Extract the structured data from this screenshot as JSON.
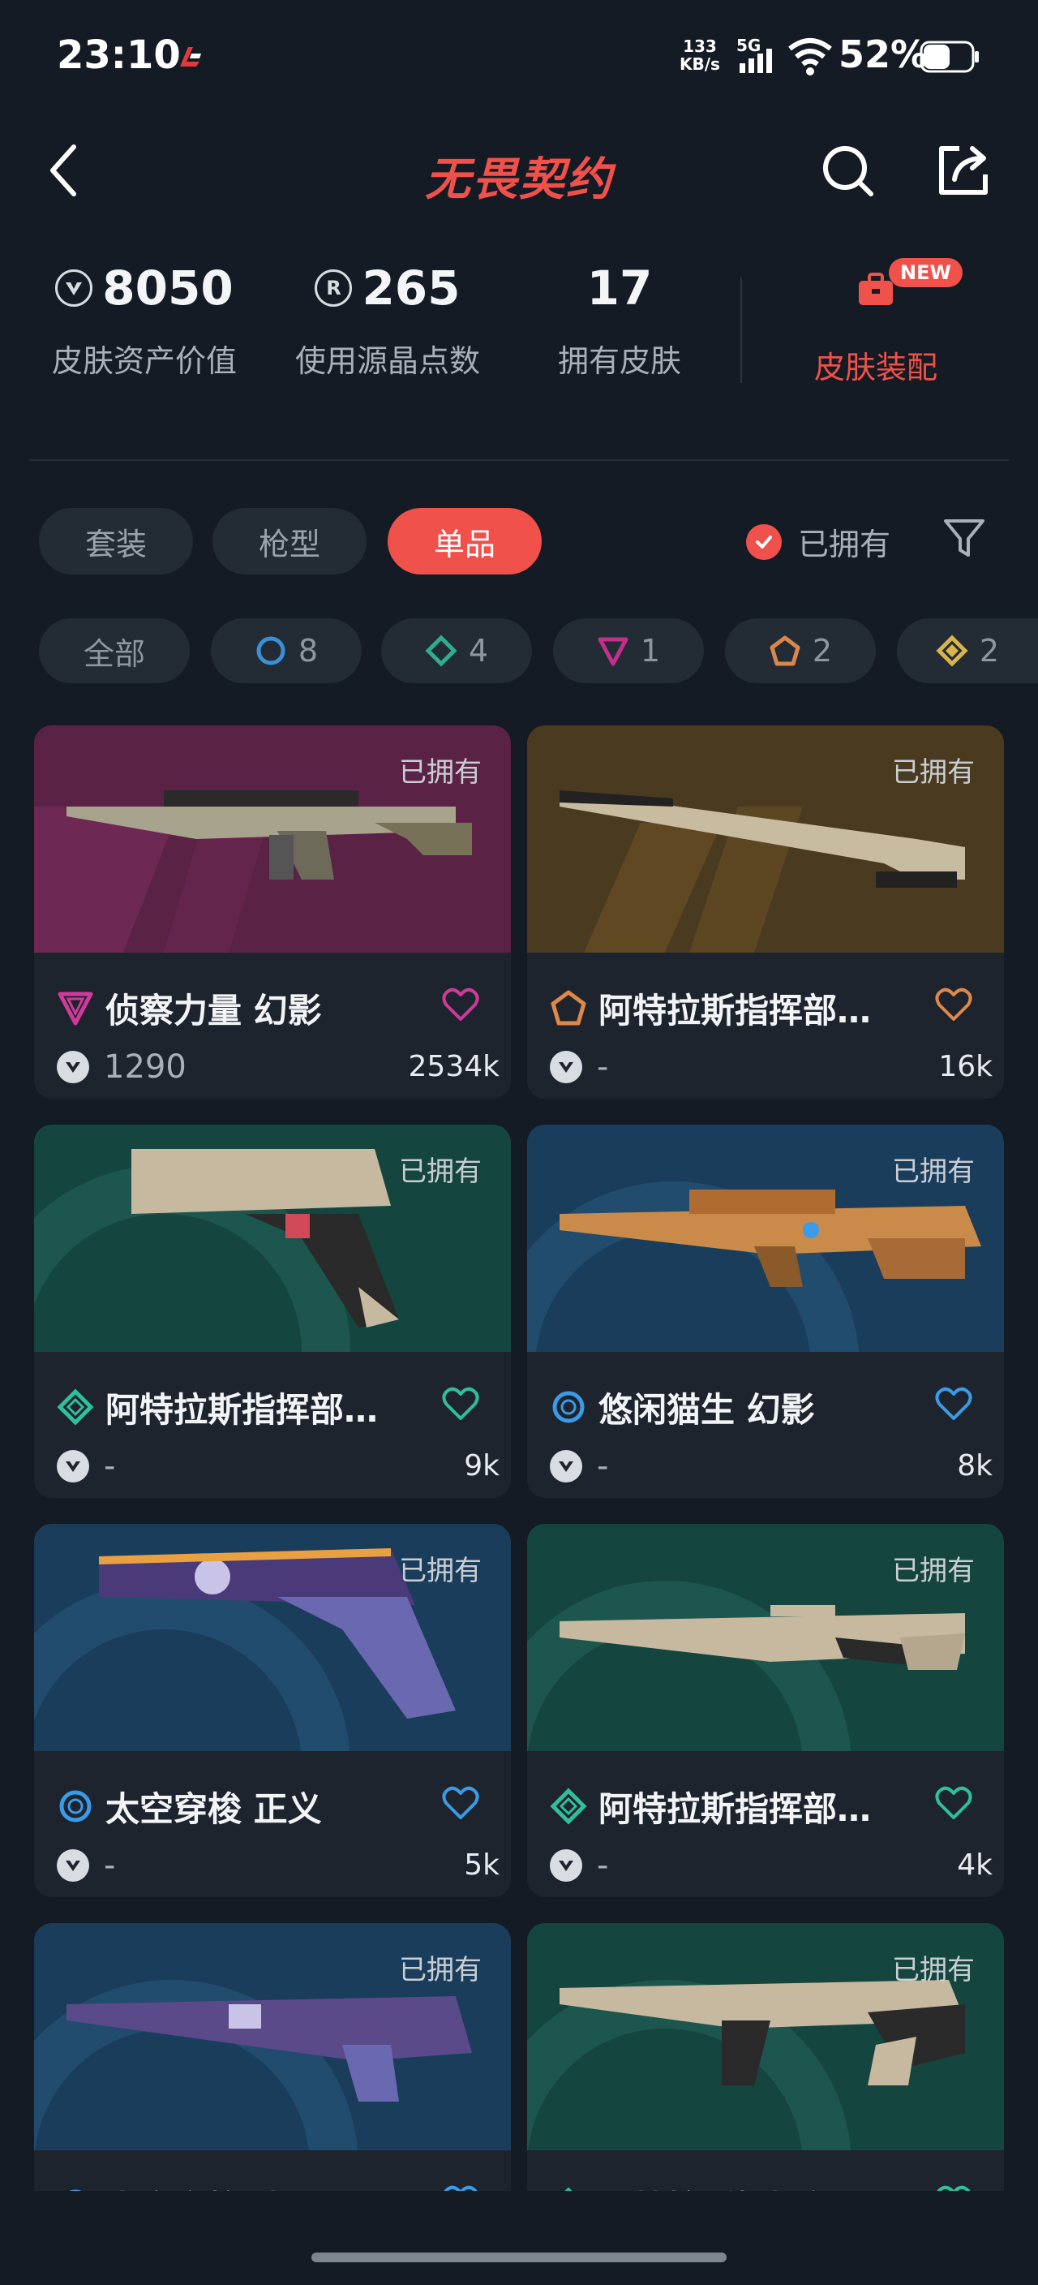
{
  "status_bar": {
    "time": "23:10",
    "net_speed_value": "133",
    "net_speed_unit": "KB/s",
    "network": "5G",
    "battery": "52%"
  },
  "header": {
    "title": "无畏契约",
    "back_icon": "back-chevron-icon",
    "search_icon": "search-icon",
    "share_icon": "share-icon"
  },
  "stats": {
    "asset_value": "8050",
    "asset_label": "皮肤资产价值",
    "radianite_points": "265",
    "radianite_label": "使用源晶点数",
    "owned_count": "17",
    "owned_label": "拥有皮肤",
    "outfit_label": "皮肤装配",
    "new_badge": "NEW"
  },
  "category_tabs": [
    {
      "label": "套装",
      "active": false
    },
    {
      "label": "枪型",
      "active": false
    },
    {
      "label": "单品",
      "active": true
    }
  ],
  "owned_filter_label": "已拥有",
  "rarity_filters": [
    {
      "label": "全部",
      "icon": "",
      "color": ""
    },
    {
      "label": "8",
      "icon": "select-tier-icon",
      "color": "#3a8fd6"
    },
    {
      "label": "4",
      "icon": "deluxe-tier-icon",
      "color": "#2fae8f"
    },
    {
      "label": "1",
      "icon": "premium-tier-icon",
      "color": "#c2308c"
    },
    {
      "label": "2",
      "icon": "exclusive-tier-icon",
      "color": "#d9874a"
    },
    {
      "label": "2",
      "icon": "ultra-tier-icon",
      "color": "#d8b54a"
    }
  ],
  "cards": [
    {
      "owned": "已拥有",
      "name": "侦察力量 幻影",
      "rarity_icon": "premium-tier-icon",
      "rarity_color": "#d03a9a",
      "price": "1290",
      "likes": "2534k",
      "heart_color": "#d03a9a"
    },
    {
      "owned": "已拥有",
      "name": "阿特拉斯指挥部…",
      "rarity_icon": "exclusive-tier-icon",
      "rarity_color": "#e0874a",
      "price": "-",
      "likes": "16k",
      "heart_color": "#e0874a"
    },
    {
      "owned": "已拥有",
      "name": "阿特拉斯指挥部…",
      "rarity_icon": "deluxe-tier-icon",
      "rarity_color": "#2fbf9a",
      "price": "-",
      "likes": "9k",
      "heart_color": "#2fbf9a"
    },
    {
      "owned": "已拥有",
      "name": "悠闲猫生 幻影",
      "rarity_icon": "select-tier-icon",
      "rarity_color": "#3a9be6",
      "price": "-",
      "likes": "8k",
      "heart_color": "#3a9be6"
    },
    {
      "owned": "已拥有",
      "name": "太空穿梭 正义",
      "rarity_icon": "select-tier-icon",
      "rarity_color": "#3a9be6",
      "price": "-",
      "likes": "5k",
      "heart_color": "#3a9be6"
    },
    {
      "owned": "已拥有",
      "name": "阿特拉斯指挥部…",
      "rarity_icon": "deluxe-tier-icon",
      "rarity_color": "#2fbf9a",
      "price": "-",
      "likes": "4k",
      "heart_color": "#2fbf9a"
    },
    {
      "owned": "已拥有",
      "name": "太空穿梭 戍卫",
      "rarity_icon": "select-tier-icon",
      "rarity_color": "#3a9be6",
      "price": "-",
      "likes": "",
      "heart_color": "#3a9be6"
    },
    {
      "owned": "已拥有",
      "name": "阿特拉斯指挥部",
      "rarity_icon": "deluxe-tier-icon",
      "rarity_color": "#2fbf9a",
      "price": "-",
      "likes": "",
      "heart_color": "#2fbf9a"
    }
  ]
}
